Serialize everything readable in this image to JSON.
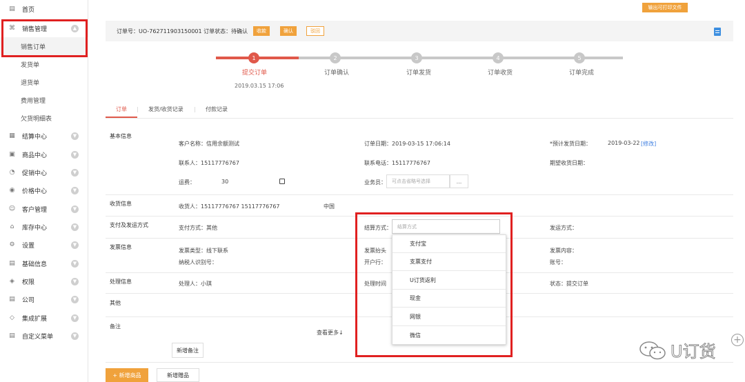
{
  "sidebar": {
    "items": [
      {
        "label": "首页",
        "icon": "home-icon"
      },
      {
        "label": "销售管理",
        "icon": "sales-icon"
      },
      {
        "label": "销售订单",
        "icon": ""
      },
      {
        "label": "发货单",
        "icon": ""
      },
      {
        "label": "退货单",
        "icon": ""
      },
      {
        "label": "费用管理",
        "icon": ""
      },
      {
        "label": "欠货明细表",
        "icon": ""
      },
      {
        "label": "结算中心",
        "icon": "settlement-icon"
      },
      {
        "label": "商品中心",
        "icon": "product-icon"
      },
      {
        "label": "促销中心",
        "icon": "promotion-icon"
      },
      {
        "label": "价格中心",
        "icon": "price-icon"
      },
      {
        "label": "客户管理",
        "icon": "customer-icon"
      },
      {
        "label": "库存中心",
        "icon": "inventory-icon"
      },
      {
        "label": "设置",
        "icon": "settings-icon"
      },
      {
        "label": "基础信息",
        "icon": "basic-info-icon"
      },
      {
        "label": "权限",
        "icon": "permission-icon"
      },
      {
        "label": "公司",
        "icon": "company-icon"
      },
      {
        "label": "集成扩展",
        "icon": "integration-icon"
      },
      {
        "label": "自定义菜单",
        "icon": "custom-menu-icon"
      }
    ]
  },
  "header": {
    "print_label": "输出可打印文件",
    "order_text": "订单号：UO-762711903150001 订单状态：待确认",
    "btn_receive": "收款",
    "btn_confirm": "确认",
    "btn_reject": "驳回"
  },
  "steps": {
    "items": [
      {
        "num": "1",
        "label": "提交订单"
      },
      {
        "num": "2",
        "label": "订单确认"
      },
      {
        "num": "3",
        "label": "订单发货"
      },
      {
        "num": "4",
        "label": "订单收货"
      },
      {
        "num": "5",
        "label": "订单完成"
      }
    ],
    "date": "2019.03.15 17:06",
    "active_color": "#e0584a",
    "inactive_color": "#c8c8c8"
  },
  "tabs": [
    {
      "label": "订单"
    },
    {
      "label": "发货/收货记录"
    },
    {
      "label": "付款记录"
    }
  ],
  "basic": {
    "title": "基本信息",
    "customer": "客户名称：信用余额测试",
    "order_date": "订单日期：2019-03-15 17:06:14",
    "delivery_label": "*预计发货日期：",
    "delivery_value": "2019-03-22",
    "modify": "[修改]",
    "contact": "联系人：15117776767",
    "phone": "联系电话：15117776767",
    "expected_receive": "期望收货日期：",
    "freight_label": "运费：",
    "freight_value": "30",
    "salesman_label": "业务员：",
    "salesman_placeholder": "可点击省略号选择",
    "dots": "..."
  },
  "receiving": {
    "title": "收货信息",
    "receiver": "收货人：15117776767  15117776767",
    "country": "中国"
  },
  "payment": {
    "title": "支付及发运方式",
    "method": "支付方式：其他",
    "settle_label": "结算方式：",
    "settle_placeholder": "结算方式",
    "ship_label": "发运方式："
  },
  "dropdown": {
    "options": [
      "支付宝",
      "支票支付",
      "U订货返利",
      "现金",
      "网银",
      "微信"
    ]
  },
  "invoice": {
    "title": "发票信息",
    "type": "发票类型：线下联系",
    "header_label": "发票抬头",
    "content_label": "发票内容：",
    "tax_label": "纳税人识别号：",
    "bank_label": "开户行：",
    "account_label": "账号："
  },
  "process": {
    "title": "处理信息",
    "handler": "处理人：小琪",
    "time_label": "处理时间",
    "status": "状态：提交订单"
  },
  "other": {
    "title": "其他"
  },
  "notes": {
    "title": "备注",
    "more": "查看更多↓",
    "add_note": "新增备注"
  },
  "bottom": {
    "add_product": "+ 新增商品",
    "add_gift": "新增赠品"
  },
  "watermark": {
    "text": "U订货"
  }
}
